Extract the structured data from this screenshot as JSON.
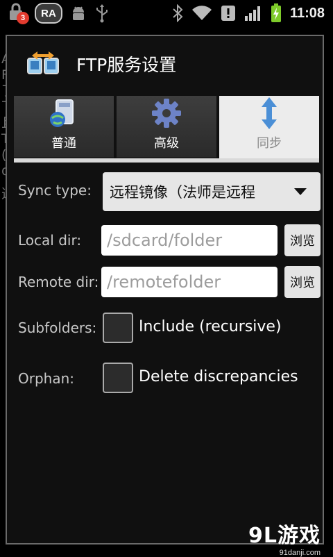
{
  "status_bar": {
    "notification_count": "3",
    "ra_label": "RA",
    "time": "11:08"
  },
  "background_text": [
    "An",
    "FT",
    "了",
    "下",
    "且",
    "Tr",
    "(S",
    "ov",
    "选"
  ],
  "dialog": {
    "title": "FTP服务设置",
    "tabs": [
      {
        "label": "普通",
        "icon": "computer-globe-icon"
      },
      {
        "label": "高级",
        "icon": "gear-icon"
      },
      {
        "label": "同步",
        "icon": "up-down-arrow-icon"
      }
    ],
    "active_tab": 2,
    "sync_type": {
      "label": "Sync type:",
      "value": "远程镜像（法师是远程"
    },
    "local_dir": {
      "label": "Local dir:",
      "value": "/sdcard/folder",
      "browse": "浏览"
    },
    "remote_dir": {
      "label": "Remote dir:",
      "value": "/remotefolder",
      "browse": "浏览"
    },
    "subfolders": {
      "label": "Subfolders:",
      "option": "Include (recursive)",
      "checked": false
    },
    "orphan": {
      "label": "Orphan:",
      "option": "Delete discrepancies",
      "checked": false
    }
  },
  "watermark": {
    "logo": "9L游戏",
    "url": "91danji.com"
  }
}
